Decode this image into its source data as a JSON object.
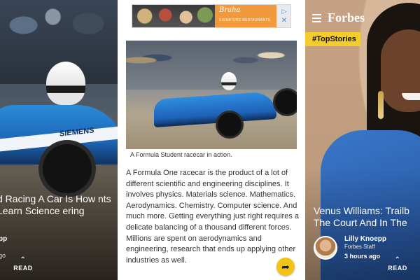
{
  "left_story": {
    "headline": "d Racing A Car Is How nts Learn Science ering",
    "logo_text": "SIEMENS",
    "author": "pp",
    "time_ago": "go",
    "read_label": "READ"
  },
  "center_article": {
    "ad": {
      "brand": "Braha",
      "tagline": "SIGNATURE RESTAURANTS",
      "adchoices_icon": "adchoices-triangle-icon",
      "close_icon": "close-x-icon"
    },
    "photo_caption": "A Formula Student racecar in action.",
    "body": "A Formula One racecar is the product of a lot of different scientific and engineering disciplines. It involves physics. Materials science. Mathematics. Aerodynamics. Chemistry. Computer science. And much more. Getting everything just right requires a delicate balancing of a thousand different forces. Millions are spent on aerodynamics and engineering, research that ends up applying other industries as well.",
    "share_icon": "share-arrow-icon",
    "accent_color": "#f2c418"
  },
  "right_story": {
    "menu_icon": "hamburger-menu-icon",
    "brand": "Forbes",
    "tag": "#TopStories",
    "headline_line1": "Venus Williams: Trailb",
    "headline_line2": "The Court And In The",
    "author_name": "Lilly Knoepp",
    "author_role": "Forbes Staff",
    "time_ago": "3 hours ago",
    "read_label": "READ",
    "tag_color": "#f5cc2e"
  }
}
